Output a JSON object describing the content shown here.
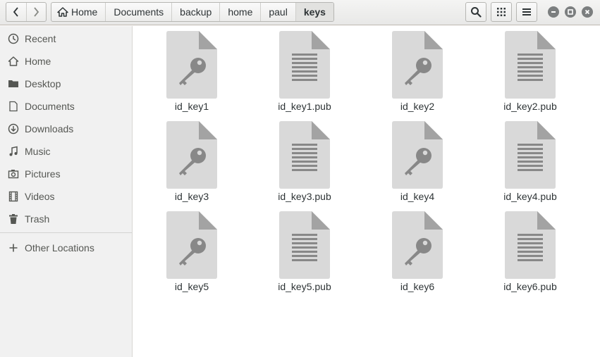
{
  "breadcrumb": [
    "Home",
    "Documents",
    "backup",
    "home",
    "paul",
    "keys"
  ],
  "sidebar": {
    "items": [
      {
        "label": "Recent",
        "icon": "clock-icon"
      },
      {
        "label": "Home",
        "icon": "home-icon"
      },
      {
        "label": "Desktop",
        "icon": "folder-icon"
      },
      {
        "label": "Documents",
        "icon": "document-icon"
      },
      {
        "label": "Downloads",
        "icon": "download-icon"
      },
      {
        "label": "Music",
        "icon": "music-icon"
      },
      {
        "label": "Pictures",
        "icon": "camera-icon"
      },
      {
        "label": "Videos",
        "icon": "film-icon"
      },
      {
        "label": "Trash",
        "icon": "trash-icon"
      }
    ],
    "other_locations": "Other Locations"
  },
  "files": [
    {
      "name": "id_key1",
      "type": "key"
    },
    {
      "name": "id_key1.pub",
      "type": "text"
    },
    {
      "name": "id_key2",
      "type": "key"
    },
    {
      "name": "id_key2.pub",
      "type": "text"
    },
    {
      "name": "id_key3",
      "type": "key"
    },
    {
      "name": "id_key3.pub",
      "type": "text"
    },
    {
      "name": "id_key4",
      "type": "key"
    },
    {
      "name": "id_key4.pub",
      "type": "text"
    },
    {
      "name": "id_key5",
      "type": "key"
    },
    {
      "name": "id_key5.pub",
      "type": "text"
    },
    {
      "name": "id_key6",
      "type": "key"
    },
    {
      "name": "id_key6.pub",
      "type": "text"
    }
  ],
  "colors": {
    "icon_page": "#d9d9d9",
    "icon_fold": "#a3a3a3",
    "icon_glyph": "#888888",
    "sidebar_bg": "#f1f1f1"
  }
}
